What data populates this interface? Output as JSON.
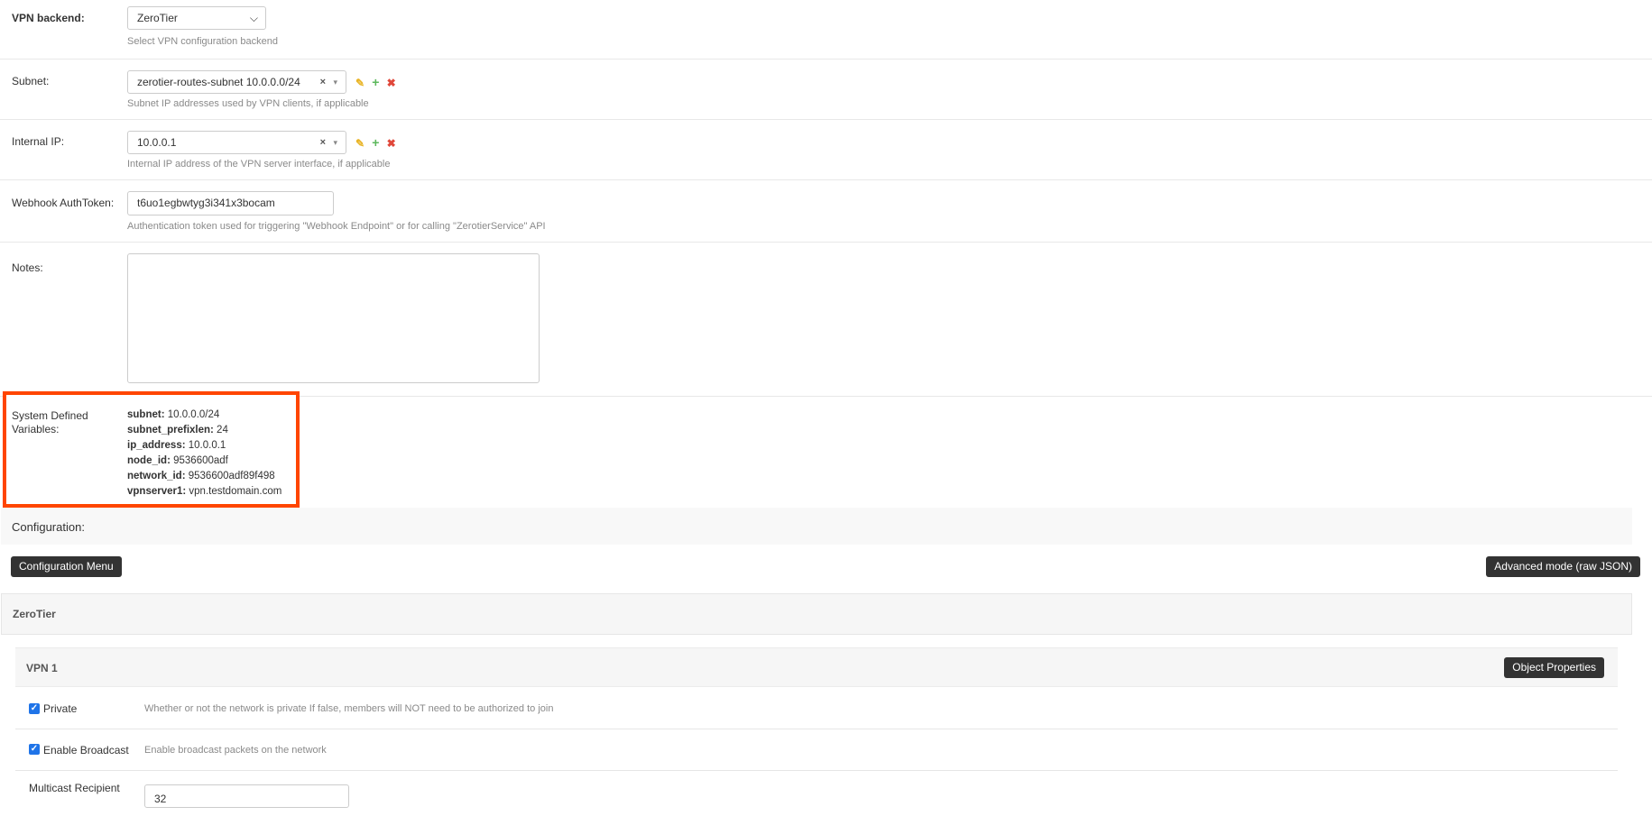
{
  "form": {
    "vpn_backend": {
      "label": "VPN backend:",
      "value": "ZeroTier",
      "help": "Select VPN configuration backend"
    },
    "subnet": {
      "label": "Subnet:",
      "value": "zerotier-routes-subnet 10.0.0.0/24",
      "help": "Subnet IP addresses used by VPN clients, if applicable"
    },
    "internal_ip": {
      "label": "Internal IP:",
      "value": "10.0.0.1",
      "help": "Internal IP address of the VPN server interface, if applicable"
    },
    "webhook": {
      "label": "Webhook AuthToken:",
      "value": "t6uo1egbwtyg3i341x3bocam",
      "help": "Authentication token used for triggering \"Webhook Endpoint\" or for calling \"ZerotierService\" API"
    },
    "notes": {
      "label": "Notes:",
      "value": ""
    },
    "related_icons": {
      "edit": "✎",
      "add": "+",
      "delete": "✖"
    },
    "select_clear": "×",
    "select_arrow": "▾",
    "select_chevron": "⌄"
  },
  "system_vars": {
    "label_line1": "System Defined",
    "label_line2": "Variables:",
    "items": [
      {
        "key": "subnet:",
        "value": " 10.0.0.0/24"
      },
      {
        "key": "subnet_prefixlen:",
        "value": " 24"
      },
      {
        "key": "ip_address:",
        "value": " 10.0.0.1"
      },
      {
        "key": "node_id:",
        "value": " 9536600adf"
      },
      {
        "key": "network_id:",
        "value": " 9536600adf89f498"
      },
      {
        "key": "vpnserver1:",
        "value": " vpn.testdomain.com"
      }
    ],
    "highlight_color": "#ff4500"
  },
  "configuration": {
    "header": "Configuration:",
    "menu_button": "Configuration Menu",
    "advanced_button": "Advanced mode (raw JSON)",
    "section_title": "ZeroTier",
    "vpn": {
      "title": "VPN 1",
      "object_properties_button": "Object Properties",
      "private": {
        "label": "Private",
        "checked": true,
        "help": "Whether or not the network is private If false, members will NOT need to be authorized to join"
      },
      "enable_broadcast": {
        "label": "Enable Broadcast",
        "checked": true,
        "help": "Enable broadcast packets on the network"
      },
      "multicast": {
        "label": "Multicast Recipient",
        "value": "32"
      }
    }
  }
}
